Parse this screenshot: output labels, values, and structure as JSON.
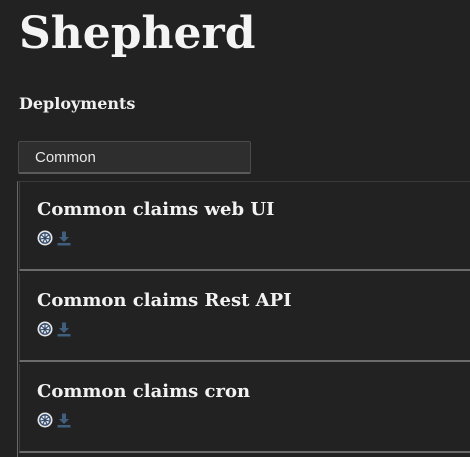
{
  "app": {
    "title": "Shepherd"
  },
  "section": {
    "title": "Deployments"
  },
  "filter": {
    "selected_label": "Common"
  },
  "deployments": [
    {
      "title": "Common claims web UI",
      "icons": [
        "kubernetes-icon",
        "download-icon"
      ]
    },
    {
      "title": "Common claims Rest API",
      "icons": [
        "kubernetes-icon",
        "download-icon"
      ]
    },
    {
      "title": "Common claims cron",
      "icons": [
        "kubernetes-icon",
        "download-icon"
      ]
    }
  ],
  "colors": {
    "background": "#222222",
    "text": "#f2f2f2",
    "kubernetes_icon": "#e6e6e6",
    "download_icon": "#3f5f7f",
    "card_border": "#6b6b6b"
  }
}
